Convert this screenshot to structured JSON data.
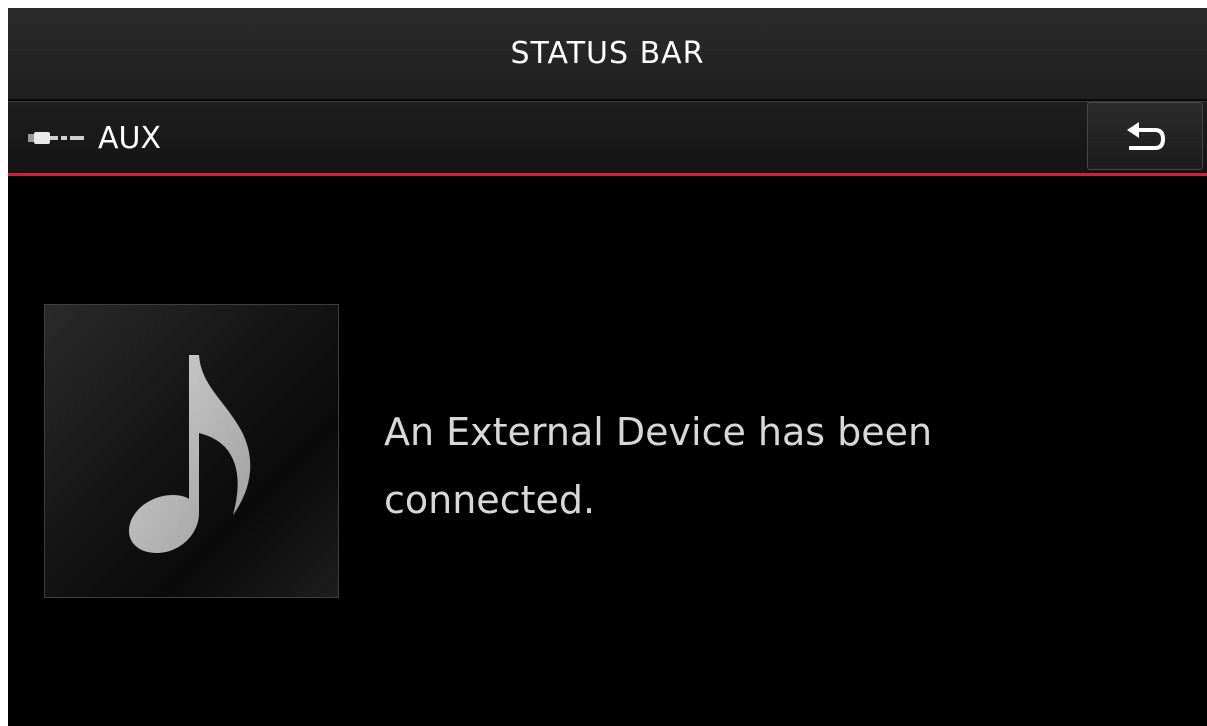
{
  "status_bar": {
    "title": "STATUS BAR"
  },
  "header": {
    "source_icon": "aux-plug-icon",
    "source_label": "AUX",
    "back_icon": "back-arrow-icon",
    "accent_color": "#d0213a"
  },
  "main": {
    "album_art_icon": "music-note-icon",
    "message": "An External Device has been connected."
  }
}
